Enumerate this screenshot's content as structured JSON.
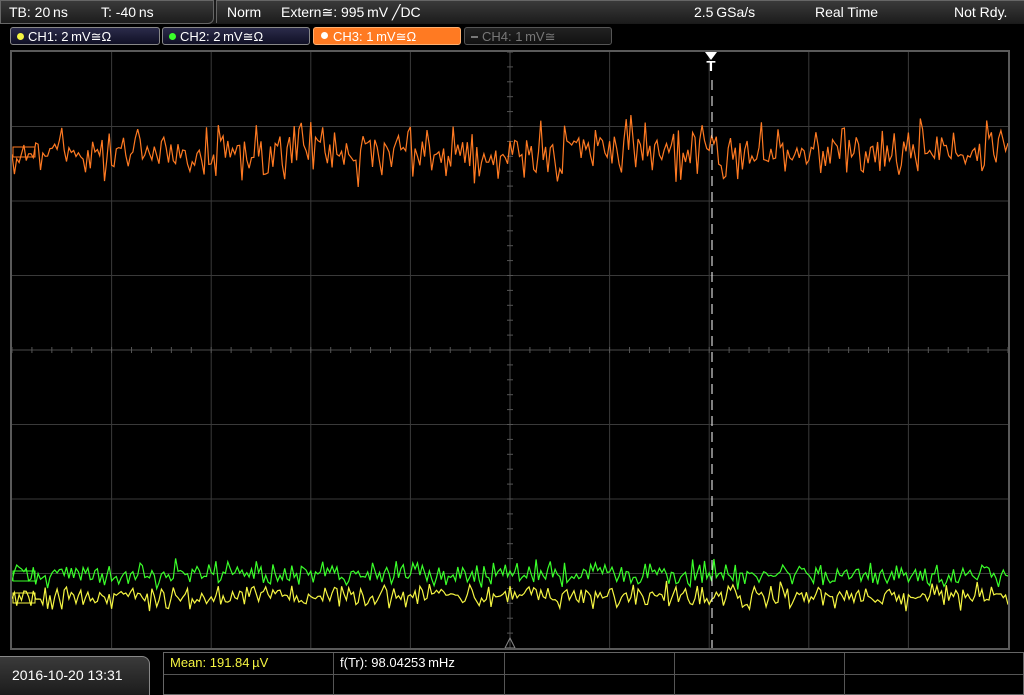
{
  "status_bar": {
    "timebase": "TB: 20 ns",
    "trigger_time": "T: -40 ns",
    "acq_mode": "Norm",
    "trigger_source": "Extern≅: 995 mV ╱DC",
    "sample_rate": "2.5 GSa/s",
    "acq_type": "Real Time",
    "ready_state": "Not Rdy."
  },
  "channels": [
    {
      "label": "CH1: 2 mV≅Ω",
      "color": "#f5f542",
      "state": "on"
    },
    {
      "label": "CH2: 2 mV≅Ω",
      "color": "#3aff2a",
      "state": "on"
    },
    {
      "label": "CH3: 1 mV≅Ω",
      "color": "#ff7a22",
      "state": "active"
    },
    {
      "label": "CH4: 1 mV≅",
      "color": "#777777",
      "state": "off"
    }
  ],
  "trigger_marker": "T",
  "timestamp": "2016-10-20 13:31",
  "measurements": {
    "mean": "Mean: 191.84 µV",
    "frequency": "f(Tr): 98.04253 mHz"
  },
  "waveform_colors": {
    "ch1": "#f5f542",
    "ch2": "#3aff2a",
    "ch3": "#ff7a22"
  }
}
